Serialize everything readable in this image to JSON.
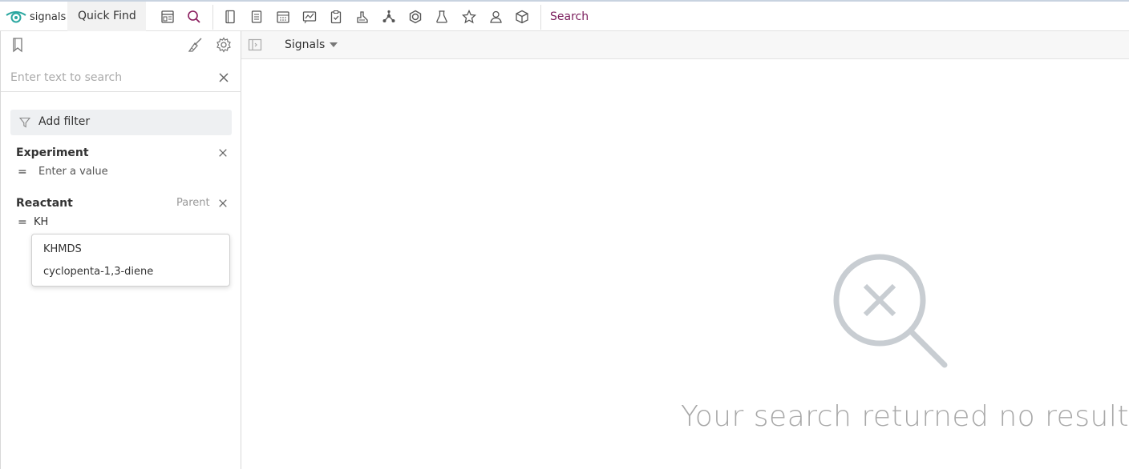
{
  "app": {
    "logo_text": "signals",
    "quick_find": "Quick Find",
    "active_tab": "Search"
  },
  "toolbar_icons": [
    "dashboard-icon",
    "search-icon",
    "notebook-icon",
    "document-icon",
    "calendar-icon",
    "chart-icon",
    "clipboard-check-icon",
    "lab-equipment-icon",
    "network-icon",
    "hexagon-icon",
    "flask-icon",
    "star-icon",
    "user-icon",
    "cube-icon"
  ],
  "sidebar": {
    "search": {
      "placeholder": "Enter text to search",
      "value": ""
    },
    "add_filter_label": "Add filter",
    "filters": [
      {
        "title": "Experiment",
        "operator": "=",
        "placeholder": "Enter a value",
        "value": ""
      },
      {
        "title": "Reactant",
        "operator": "=",
        "value": "KH",
        "parent_label": "Parent"
      }
    ],
    "suggestions": [
      "KHMDS",
      "cyclopenta-1,3-diene"
    ]
  },
  "main": {
    "scope_label": "Signals",
    "empty_message": "Your search returned no results."
  }
}
